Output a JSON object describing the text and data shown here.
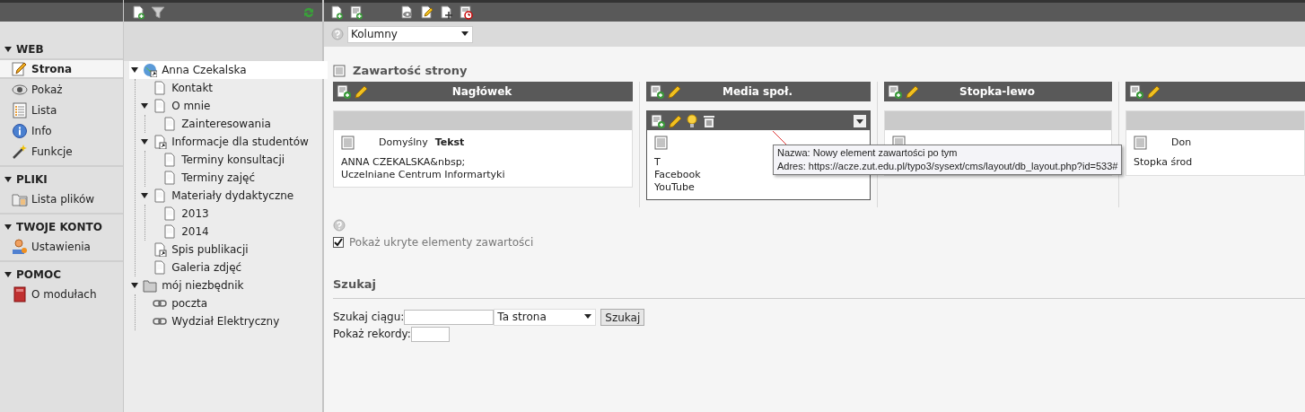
{
  "module_menu": {
    "sections": [
      {
        "title": "WEB",
        "expanded": true,
        "items": [
          {
            "label": "Strona",
            "selected": true
          },
          {
            "label": "Pokaż",
            "selected": false
          },
          {
            "label": "Lista",
            "selected": false
          },
          {
            "label": "Info",
            "selected": false
          },
          {
            "label": "Funkcje",
            "selected": false
          }
        ]
      },
      {
        "title": "PLIKI",
        "expanded": true,
        "items": [
          {
            "label": "Lista plików",
            "selected": false
          }
        ]
      },
      {
        "title": "TWOJE KONTO",
        "expanded": true,
        "items": [
          {
            "label": "Ustawienia",
            "selected": false
          }
        ]
      },
      {
        "title": "POMOC",
        "expanded": true,
        "items": [
          {
            "label": "O modułach",
            "selected": false
          }
        ]
      }
    ]
  },
  "page_tree": {
    "nodes": [
      {
        "label": "Anna Czekalska",
        "kind": "root",
        "selected": true,
        "expanded": true,
        "children": [
          {
            "label": "Kontakt",
            "kind": "page",
            "selected": false
          },
          {
            "label": "O mnie",
            "kind": "page",
            "selected": false,
            "expanded": true,
            "children": [
              {
                "label": "Zainteresowania",
                "kind": "page",
                "selected": false
              }
            ]
          },
          {
            "label": "Informacje dla studentów",
            "kind": "shortcut",
            "selected": false,
            "expanded": true,
            "children": [
              {
                "label": "Terminy konsultacji",
                "kind": "page",
                "selected": false
              },
              {
                "label": "Terminy zajęć",
                "kind": "page",
                "selected": false
              }
            ]
          },
          {
            "label": "Materiały dydaktyczne",
            "kind": "page",
            "selected": false,
            "expanded": true,
            "children": [
              {
                "label": "2013",
                "kind": "page",
                "selected": false
              },
              {
                "label": "2014",
                "kind": "page",
                "selected": false
              }
            ]
          },
          {
            "label": "Spis publikacji",
            "kind": "shortcut",
            "selected": false
          },
          {
            "label": "Galeria zdjęć",
            "kind": "page",
            "selected": false
          }
        ]
      },
      {
        "label": "mój niezbędnik",
        "kind": "folder",
        "selected": false,
        "expanded": true,
        "children": [
          {
            "label": "poczta",
            "kind": "link",
            "selected": false
          },
          {
            "label": "Wydział Elektryczny",
            "kind": "link",
            "selected": false
          }
        ]
      }
    ]
  },
  "view_select": {
    "value": "Kolumny"
  },
  "content": {
    "title": "Zawartość strony",
    "columns": [
      {
        "title": "Nagłówek",
        "elements": [
          {
            "hovered": false,
            "type_label": "Domyślny",
            "ctype": "Tekst",
            "lines": [
              "ANNA CZEKALSKA&nbsp;",
              "Uczelniane Centrum Informartyki"
            ]
          }
        ]
      },
      {
        "title": "Media społ.",
        "elements": [
          {
            "hovered": true,
            "lines": [
              "T",
              "Facebook",
              "YouTube"
            ]
          }
        ]
      },
      {
        "title": "Stopka-lewo",
        "elements": [
          {
            "hovered": false
          }
        ]
      },
      {
        "elements": [
          {
            "hovered": false,
            "type_label": "Don",
            "lines": [
              "Stopka środ"
            ]
          }
        ]
      }
    ]
  },
  "show_hidden": {
    "label": "Pokaż ukryte elementy zawartości",
    "checked": true
  },
  "search": {
    "title": "Szukaj",
    "query_label": "Szukaj ciągu:",
    "scope": "Ta strona",
    "button": "Szukaj",
    "records_label": "Pokaż rekordy:"
  },
  "tooltip": {
    "lines": [
      "Nazwa: Nowy element zawartości po tym",
      "Adres: https://acze.zut.edu.pl/typo3/sysext/cms/layout/db_layout.php?id=533#"
    ]
  }
}
